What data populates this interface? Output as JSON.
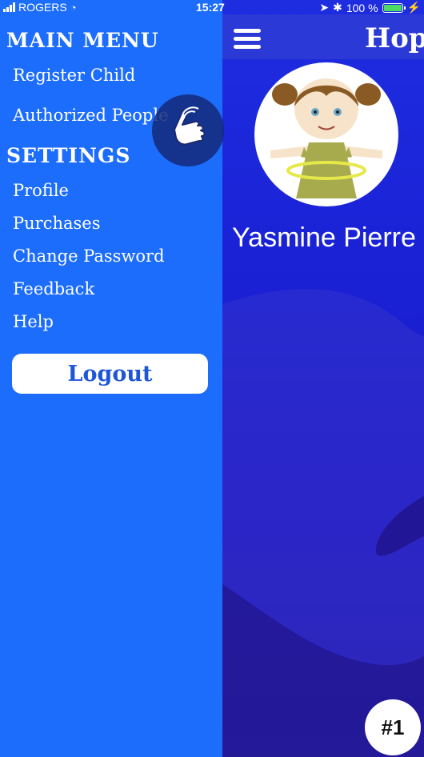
{
  "status_bar": {
    "carrier": "ROGERS",
    "time": "15:27",
    "battery_percent": "100 %",
    "icons": [
      "signal-icon",
      "wifi-icon",
      "location-arrow-icon",
      "bluetooth-icon",
      "battery-icon",
      "charging-icon"
    ]
  },
  "drawer": {
    "main_menu_title": "MAIN MENU",
    "main_menu_items": [
      "Register Child",
      "Authorized People"
    ],
    "settings_title": "SETTINGS",
    "settings_items": [
      "Profile",
      "Purchases",
      "Change Password",
      "Feedback",
      "Help"
    ],
    "logout_label": "Logout"
  },
  "app": {
    "header_title": "Hop",
    "child_name": "Yasmine Pierre",
    "badge_label": "#1"
  },
  "colors": {
    "drawer_bg": "#1c6dfb",
    "app_bg": "#1a20d4",
    "logout_text": "#1f56d6"
  }
}
